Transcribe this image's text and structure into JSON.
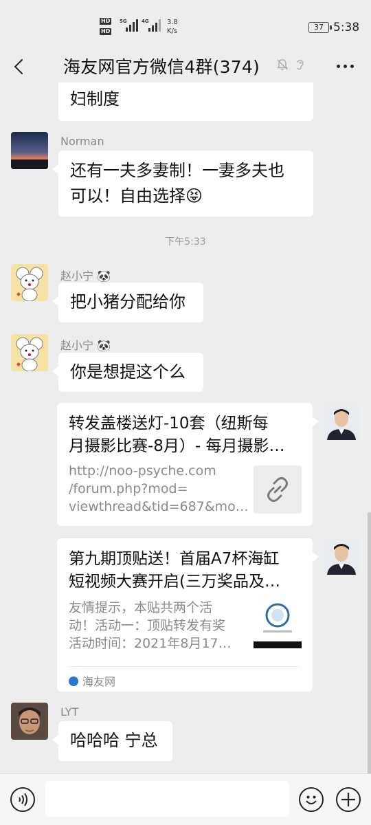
{
  "status_bar": {
    "hd1": "HD",
    "hd2": "HD",
    "gen1": "5G",
    "gen2": "4G",
    "speed_value": "3.8",
    "speed_unit": "K/s",
    "battery": "37",
    "time": "5:38"
  },
  "header": {
    "title": "海友网官方微信4群(374)"
  },
  "messages": {
    "m0": {
      "text": "妇制度"
    },
    "m1": {
      "sender": "Norman",
      "line1": "还有一夫多妻制！一妻多夫也",
      "line2": "可以！自由选择",
      "emoji": "😝"
    },
    "timestamp": "下午5:33",
    "m2": {
      "sender": "赵小宁",
      "sender_emoji": "🐼",
      "text": "把小猪分配给你"
    },
    "m3": {
      "sender": "赵小宁",
      "sender_emoji": "🐼",
      "text": "你是想提这个么"
    },
    "card1": {
      "title_line1": "转发盖楼送灯-10套（纽斯每",
      "title_line2": "月摄影比赛-8月）- 每月摄影…",
      "desc_line1": "http://noo-psyche.com",
      "desc_line2": "/forum.php?mod=",
      "desc_line3": "viewthread&tid=687&mo…"
    },
    "card2": {
      "title_line1": "第九期顶贴送！首届A7杯海缸",
      "title_line2": "短视频大赛开启(三万奖品及…",
      "desc_line1": "友情提示，本贴共两个活",
      "desc_line2": "动！活动一：顶贴转发有奖",
      "desc_line3": "活动时间：2021年8月17…",
      "source": "海友网"
    },
    "m4": {
      "sender": "LYT",
      "text": "哈哈哈 宁总"
    }
  },
  "input": {
    "placeholder": ""
  },
  "colors": {
    "background": "#ededed",
    "bubble": "#ffffff",
    "meta_text": "#888888"
  },
  "icons": {
    "back": "chevron-left-icon",
    "mute": "bell-off-icon",
    "ear": "ear-icon",
    "more": "more-dots-icon",
    "voice": "voice-icon",
    "emoji": "emoji-icon",
    "plus": "plus-icon",
    "link": "link-icon"
  }
}
